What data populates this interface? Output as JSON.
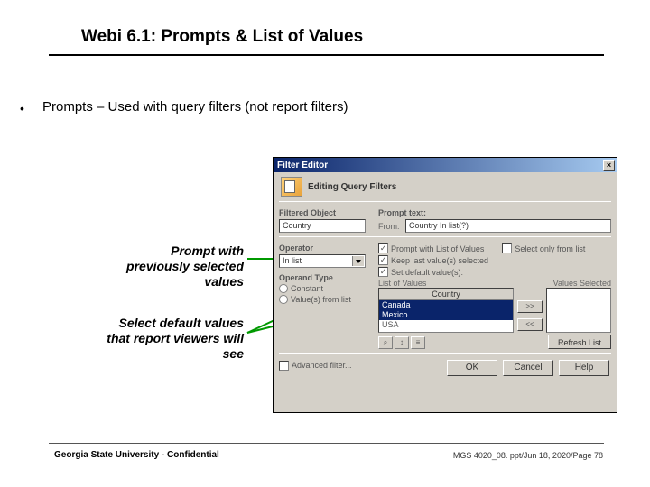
{
  "slide": {
    "title": "Webi 6.1: Prompts & List of Values",
    "bullet": "Prompts – Used with query filters (not report filters)"
  },
  "annotations": {
    "a1": "Prompt with previously selected values",
    "a2": "Select default values that report viewers will see"
  },
  "dialog": {
    "title": "Filter Editor",
    "close": "×",
    "heading": "Editing Query Filters",
    "filtered_object_label": "Filtered Object",
    "filtered_object_value": "Country",
    "prompt_text_label": "Prompt text:",
    "prompt_field_label": "From:",
    "prompt_field_value": "Country In list(?)",
    "operator_label": "Operator",
    "operator_value": "In list",
    "operand_type_label": "Operand Type",
    "operand_constant": "Constant",
    "operand_fromlist": "Value(s) from list",
    "chk_prompt_lov": "Prompt with List of Values",
    "chk_select_only": "Select only from list",
    "chk_keep_last": "Keep last value(s) selected",
    "chk_set_default": "Set default value(s):",
    "lov_label": "List of Values",
    "values_selected_label": "Values Selected",
    "country_header": "Country",
    "items": {
      "i0": "Canada",
      "i1": "Mexico",
      "i2": "USA"
    },
    "btn_add": ">>",
    "btn_remove": "<<",
    "advanced_filter": "Advanced filter...",
    "refresh_list": "Refresh List",
    "ok": "OK",
    "cancel": "Cancel",
    "help": "Help"
  },
  "footer": {
    "left": "Georgia State University - Confidential",
    "right": "MGS 4020_08. ppt/Jun 18, 2020/Page 78"
  }
}
